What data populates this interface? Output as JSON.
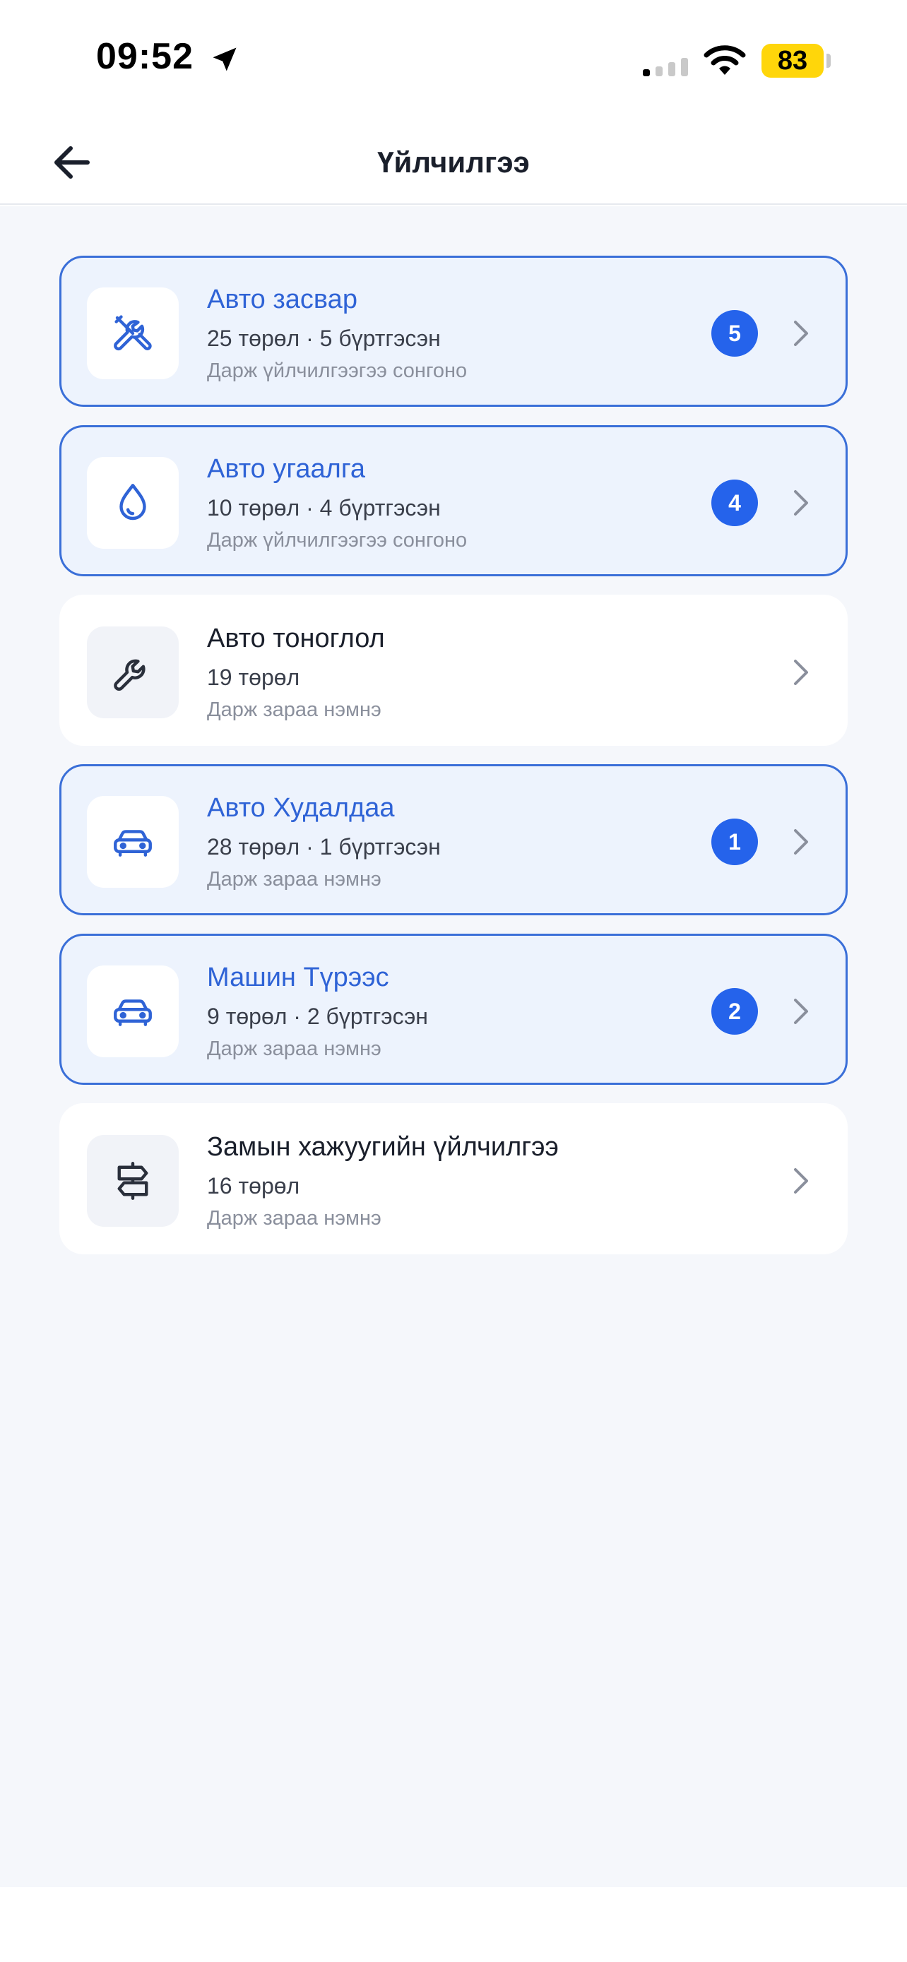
{
  "status_bar": {
    "time": "09:52",
    "battery": "83"
  },
  "header": {
    "title": "Үйлчилгээ"
  },
  "colors": {
    "accent": "#2563eb",
    "selected_bg": "#edf3fd",
    "selected_border": "#3a6fd8",
    "page_bg": "#f5f7fb"
  },
  "services": [
    {
      "title": "Авто засвар",
      "subtitle": "25 төрөл · 5 бүртгэсэн",
      "hint": "Дарж үйлчилгээгээ сонгоно",
      "badge": "5",
      "selected": true,
      "icon": "tools-icon"
    },
    {
      "title": "Авто угаалга",
      "subtitle": "10 төрөл · 4 бүртгэсэн",
      "hint": "Дарж үйлчилгээгээ сонгоно",
      "badge": "4",
      "selected": true,
      "icon": "water-drop-icon"
    },
    {
      "title": "Авто тоноглол",
      "subtitle": "19 төрөл",
      "hint": "Дарж зараа нэмнэ",
      "badge": null,
      "selected": false,
      "icon": "wrench-icon"
    },
    {
      "title": "Авто Худалдаа",
      "subtitle": "28 төрөл · 1 бүртгэсэн",
      "hint": "Дарж зараа нэмнэ",
      "badge": "1",
      "selected": true,
      "icon": "car-icon"
    },
    {
      "title": "Машин Түрээс",
      "subtitle": "9 төрөл · 2 бүртгэсэн",
      "hint": "Дарж зараа нэмнэ",
      "badge": "2",
      "selected": true,
      "icon": "car-icon"
    },
    {
      "title": "Замын хажуугийн үйлчилгээ",
      "subtitle": "16 төрөл",
      "hint": "Дарж зараа нэмнэ",
      "badge": null,
      "selected": false,
      "icon": "signpost-icon"
    }
  ]
}
